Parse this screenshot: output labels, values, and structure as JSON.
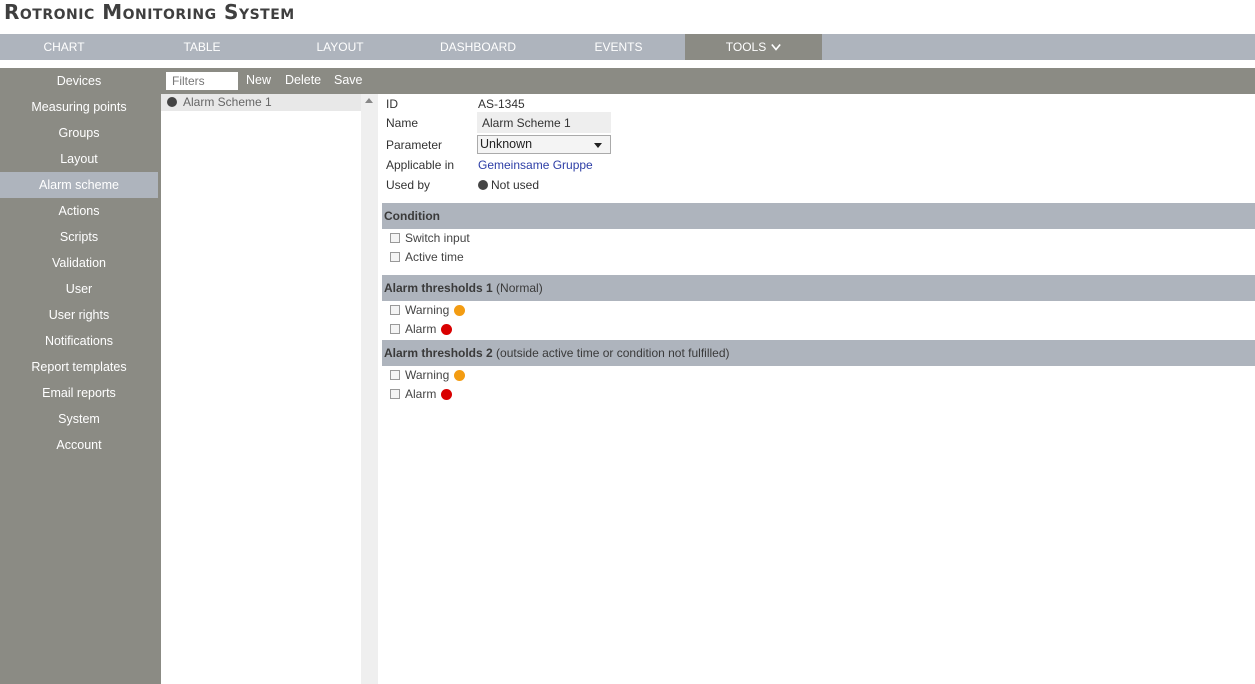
{
  "app": {
    "title": "Rotronic Monitoring System"
  },
  "topnav": {
    "items": [
      {
        "label": "CHART"
      },
      {
        "label": "TABLE"
      },
      {
        "label": "LAYOUT"
      },
      {
        "label": "DASHBOARD"
      },
      {
        "label": "EVENTS"
      },
      {
        "label": "TOOLS"
      }
    ]
  },
  "sidebar": {
    "items": [
      {
        "label": "Devices"
      },
      {
        "label": "Measuring points"
      },
      {
        "label": "Groups"
      },
      {
        "label": "Layout"
      },
      {
        "label": "Alarm scheme"
      },
      {
        "label": "Actions"
      },
      {
        "label": "Scripts"
      },
      {
        "label": "Validation"
      },
      {
        "label": "User"
      },
      {
        "label": "User rights"
      },
      {
        "label": "Notifications"
      },
      {
        "label": "Report templates"
      },
      {
        "label": "Email reports"
      },
      {
        "label": "System"
      },
      {
        "label": "Account"
      }
    ]
  },
  "toolbar": {
    "filter_placeholder": "Filters",
    "new_label": "New",
    "delete_label": "Delete",
    "save_label": "Save"
  },
  "list": {
    "items": [
      {
        "label": "Alarm Scheme 1"
      }
    ]
  },
  "detail": {
    "id_label": "ID",
    "id_value": "AS-1345",
    "name_label": "Name",
    "name_value": "Alarm Scheme 1",
    "parameter_label": "Parameter",
    "parameter_value": "Unknown",
    "applicable_label": "Applicable in",
    "applicable_value": "Gemeinsame Gruppe",
    "used_by_label": "Used by",
    "used_by_value": "Not used"
  },
  "condition": {
    "title": "Condition",
    "switch_input": "Switch input",
    "active_time": "Active time"
  },
  "thresholds1": {
    "title": "Alarm thresholds 1",
    "subtitle": "(Normal)",
    "warning": "Warning",
    "alarm": "Alarm"
  },
  "thresholds2": {
    "title": "Alarm thresholds 2",
    "subtitle": "(outside active time or condition not fulfilled)",
    "warning": "Warning",
    "alarm": "Alarm"
  },
  "colors": {
    "warning": "#f39c12",
    "alarm": "#d90000",
    "nav_bg": "#aeb4bd",
    "sidebar_bg": "#8b8b84"
  }
}
